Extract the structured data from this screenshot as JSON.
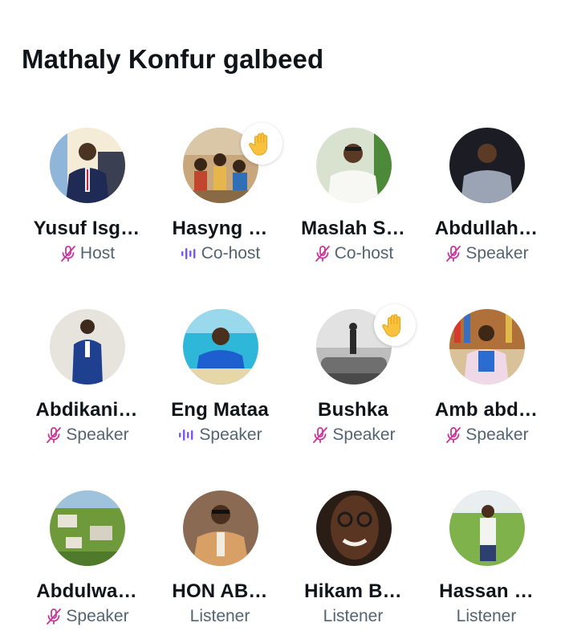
{
  "space": {
    "title": "Mathaly Konfur galbeed"
  },
  "participants": [
    {
      "name": "Yusuf Isg…",
      "role": "Host",
      "mic": "muted-mic-icon",
      "hand": false
    },
    {
      "name": "Hasyng …",
      "role": "Co-host",
      "mic": "speaking-wave-icon",
      "hand": true
    },
    {
      "name": "Maslah S…",
      "role": "Co-host",
      "mic": "muted-mic-icon",
      "hand": false
    },
    {
      "name": "Abdullah…",
      "role": "Speaker",
      "mic": "muted-mic-icon",
      "hand": false
    },
    {
      "name": "Abdikani…",
      "role": "Speaker",
      "mic": "muted-mic-icon",
      "hand": false
    },
    {
      "name": "Eng Mataa",
      "role": "Speaker",
      "mic": "speaking-wave-icon",
      "hand": false
    },
    {
      "name": "Bushka",
      "role": "Speaker",
      "mic": "muted-mic-icon",
      "hand": true
    },
    {
      "name": "Amb abd…",
      "role": "Speaker",
      "mic": "muted-mic-icon",
      "hand": false
    },
    {
      "name": "Abdulwa…",
      "role": "Speaker",
      "mic": "muted-mic-icon",
      "hand": false
    },
    {
      "name": "HON AB…",
      "role": "Listener",
      "mic": "",
      "hand": false
    },
    {
      "name": "Hikam B…",
      "role": "Listener",
      "mic": "",
      "hand": false
    },
    {
      "name": "Hassan …",
      "role": "Listener",
      "mic": "",
      "hand": false
    }
  ],
  "colors": {
    "muted_mic": "#c9369a",
    "speaking_wave": "#7856ff",
    "role_text": "#536471",
    "hand": "#f9c23c"
  }
}
